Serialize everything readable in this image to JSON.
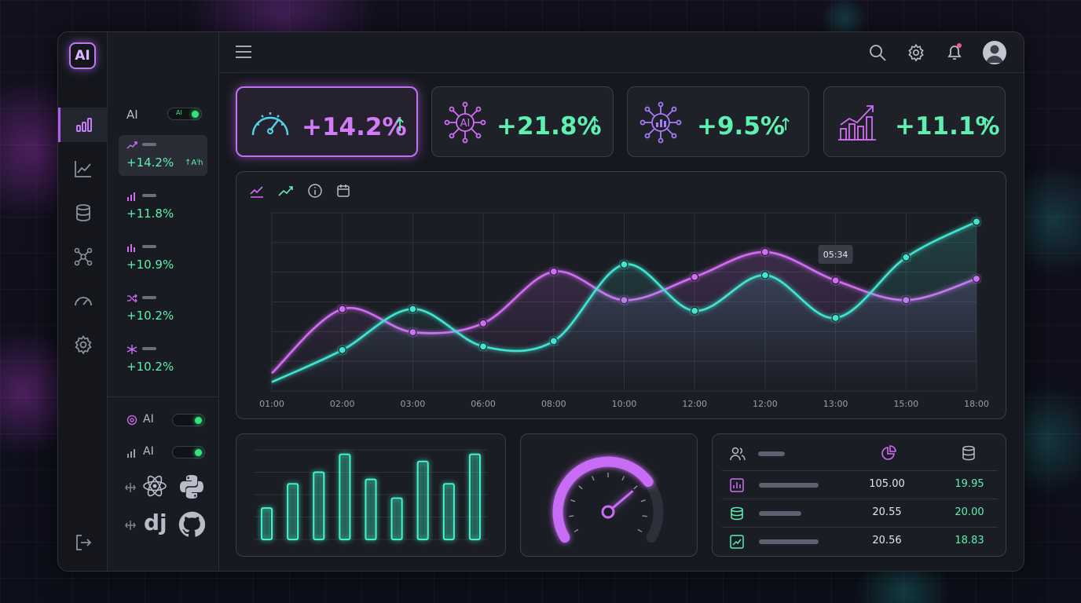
{
  "app": {
    "logo_text": "AI"
  },
  "sidebar_panel": {
    "header": "AI",
    "header_toggle_text": "AI",
    "items": [
      {
        "value": "+14.2%",
        "spark": "↑Aᴵh",
        "icon": "trend-icon",
        "active": true
      },
      {
        "value": "+11.8%",
        "icon": "bars-icon"
      },
      {
        "value": "+10.9%",
        "icon": "bars-icon"
      },
      {
        "value": "+10.2%",
        "icon": "shuffle-icon"
      },
      {
        "value": "+10.2%",
        "icon": "spark-icon"
      }
    ],
    "toggles": [
      {
        "label": "AI",
        "on": true
      },
      {
        "label": "AI",
        "on": true
      }
    ],
    "tech": [
      "dj"
    ]
  },
  "stats": [
    {
      "value": "+14.2%",
      "arrow": "↑",
      "icon": "speedometer-icon",
      "color": "#d27df7"
    },
    {
      "value": "+21.8%",
      "arrow": "↑",
      "icon": "ai-network-icon",
      "icon_text": "AI",
      "color": "#5ef0b0"
    },
    {
      "value": "+9.5%",
      "arrow": "↑",
      "icon": "network-icon",
      "color": "#5ef0b0"
    },
    {
      "value": "+11.1%",
      "arrow": "↑",
      "icon": "bar-growth-icon",
      "color": "#5ef0b0"
    }
  ],
  "chart_data": {
    "type": "line",
    "categories": [
      "01:00",
      "02:00",
      "03:00",
      "06:00",
      "08:00",
      "10:00",
      "12:00",
      "12:00",
      "13:00",
      "15:00",
      "18:00"
    ],
    "ylim": [
      0,
      10
    ],
    "grid": true,
    "series": [
      {
        "color": "#d36cf5",
        "values": [
          1.0,
          4.6,
          3.3,
          3.8,
          6.7,
          5.1,
          6.4,
          7.8,
          6.2,
          5.1,
          6.3
        ]
      },
      {
        "color": "#3fe5d2",
        "values": [
          0.5,
          2.3,
          4.6,
          2.5,
          2.8,
          7.1,
          4.5,
          6.5,
          4.1,
          7.5,
          9.5
        ]
      }
    ],
    "tooltip": {
      "text": "05:34",
      "category_index": 8
    }
  },
  "bar_chart": {
    "type": "bar",
    "values": [
      3.5,
      6.2,
      7.5,
      9.5,
      6.7,
      4.6,
      8.7,
      6.2,
      9.5
    ],
    "ylim": [
      0,
      10
    ],
    "color": "#3ff0c9"
  },
  "gauge": {
    "value": 0.72,
    "color": "#c96cf5"
  },
  "table": {
    "header_icons": [
      "users-icon",
      "pie-chart-icon",
      "database-icon"
    ],
    "rows": [
      {
        "icon": "bar-chart-icon",
        "col1": "105.00",
        "col2": "19.95"
      },
      {
        "icon": "database-icon",
        "col1": "20.55",
        "col2": "20.00"
      },
      {
        "icon": "trend-icon",
        "col1": "20.56",
        "col2": "18.83"
      }
    ]
  }
}
